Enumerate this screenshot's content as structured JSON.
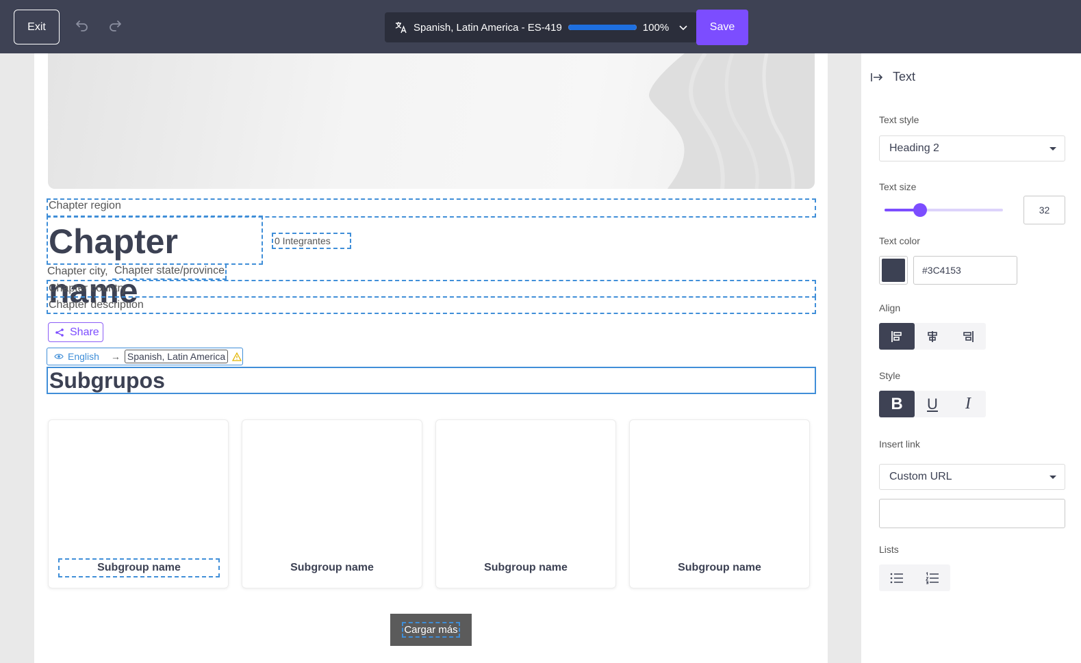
{
  "toolbar": {
    "exit_label": "Exit",
    "language": "Spanish, Latin America - ES-419",
    "progress_percent": 100,
    "progress_label": "100%",
    "save_label": "Save",
    "accent_color": "#7c4dff",
    "bar_color": "#3e4254"
  },
  "page": {
    "chapter_region": "Chapter region",
    "chapter_name": "Chapter name",
    "members": "0 Integrantes",
    "chapter_city": "Chapter city,",
    "chapter_state": "Chapter state/province",
    "chapter_country": "Chapter country",
    "chapter_description": "Chapter description",
    "share_label": "Share",
    "source_language": "English",
    "target_language": "Spanish, Latin America",
    "section_title": "Subgrupos",
    "subgroups": [
      {
        "name": "Subgroup name"
      },
      {
        "name": "Subgroup name"
      },
      {
        "name": "Subgroup name"
      },
      {
        "name": "Subgroup name"
      }
    ],
    "load_more_label": "Cargar más"
  },
  "panel": {
    "title": "Text",
    "text_style_label": "Text style",
    "text_style_value": "Heading 2",
    "text_size_label": "Text size",
    "text_size_value": "32",
    "text_size_slider_fraction": 0.3,
    "text_color_label": "Text color",
    "text_color_value": "#3C4153",
    "align_label": "Align",
    "style_label": "Style",
    "insert_link_label": "Insert link",
    "insert_link_value": "Custom URL",
    "url_value": "",
    "lists_label": "Lists",
    "icons": {
      "collapse": "collapse-panel-icon",
      "align": [
        "align-left-icon",
        "align-center-icon",
        "align-right-icon"
      ],
      "style": [
        "bold-icon",
        "underline-icon",
        "italic-icon"
      ],
      "lists": [
        "bulleted-list-icon",
        "numbered-list-icon"
      ]
    }
  }
}
